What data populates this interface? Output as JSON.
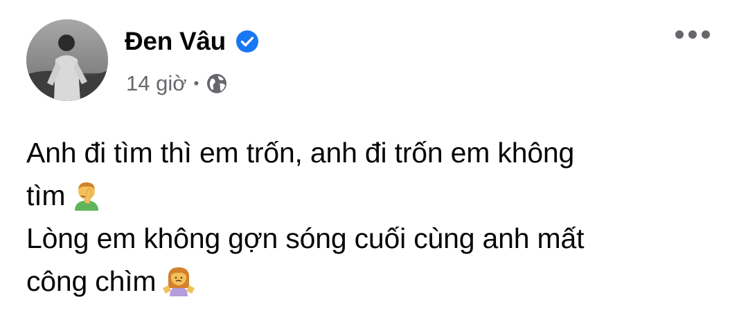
{
  "post": {
    "author_name": "Đen Vâu",
    "timestamp": "14 giờ",
    "separator": "•",
    "privacy_icon": "globe-icon",
    "verified_icon": "verified-badge-icon",
    "more_icon": "more-options-icon",
    "text_lines": [
      "Anh đi tìm thì em trốn, anh đi trốn em không",
      "tìm",
      "Lòng em không gợn sóng cuối cùng anh mất",
      "công chìm"
    ],
    "emojis": [
      "man-facepalming-emoji",
      "woman-shrugging-emoji"
    ]
  },
  "colors": {
    "verified": "#1877f2",
    "meta_text": "#65676b",
    "body_text": "#050505"
  }
}
